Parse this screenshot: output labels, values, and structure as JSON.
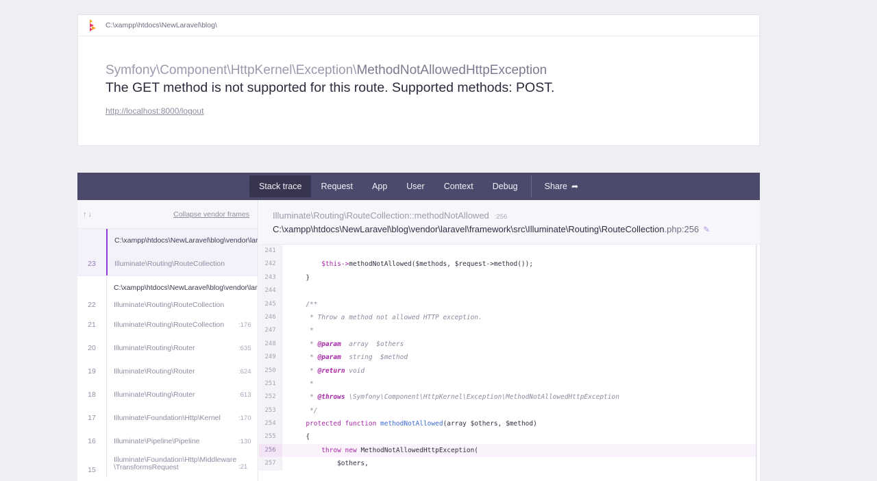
{
  "header": {
    "path": "C:\\xampp\\htdocs\\NewLaravel\\blog\\",
    "exception_namespace": "Symfony\\Component\\HttpKernel\\Exception\\",
    "exception_class": "MethodNotAllowedHttpException",
    "message": "The GET method is not supported for this route. Supported methods: POST.",
    "url": "http://localhost:8000/logout"
  },
  "tabs": [
    {
      "label": "Stack trace"
    },
    {
      "label": "Request"
    },
    {
      "label": "App"
    },
    {
      "label": "User"
    },
    {
      "label": "Context"
    },
    {
      "label": "Debug"
    },
    {
      "label": "Share"
    }
  ],
  "sidebar": {
    "arrows": "↑↓",
    "collapse_label": "Collapse vendor frames",
    "active_group_path": "C:\\xampp\\htdocs\\NewLaravel\\blog\\vendor\\laravel",
    "second_group_path": "C:\\xampp\\htdocs\\NewLaravel\\blog\\vendor\\laravel",
    "frames": [
      {
        "num": "23",
        "cls": "Illuminate\\Routing\\RouteCollection",
        "line": ""
      },
      {
        "num": "22",
        "cls": "Illuminate\\Routing\\RouteCollection",
        "line": ""
      },
      {
        "num": "21",
        "cls": "Illuminate\\Routing\\RouteCollection",
        "line": ":176"
      },
      {
        "num": "20",
        "cls": "Illuminate\\Routing\\Router",
        "line": ":635"
      },
      {
        "num": "19",
        "cls": "Illuminate\\Routing\\Router",
        "line": ":624"
      },
      {
        "num": "18",
        "cls": "Illuminate\\Routing\\Router",
        "line": ":613"
      },
      {
        "num": "17",
        "cls": "Illuminate\\Foundation\\Http\\Kernel",
        "line": ":170"
      },
      {
        "num": "16",
        "cls": "Illuminate\\Pipeline\\Pipeline",
        "line": ":130"
      },
      {
        "num": "15",
        "cls": "Illuminate\\Foundation\\Http\\Middleware\\TransformsRequest",
        "line": ":21"
      }
    ]
  },
  "source": {
    "method": "Illuminate\\Routing\\RouteCollection::methodNotAllowed",
    "method_line": ":256",
    "file_path": "C:\\xampp\\htdocs\\NewLaravel\\blog\\vendor\\laravel\\framework\\src\\Illuminate\\Routing\\RouteCollection",
    "file_ext": ".php:256",
    "lines": [
      {
        "n": "241",
        "code": ""
      },
      {
        "n": "242",
        "code": "        $this->methodNotAllowed($methods, $request->method());"
      },
      {
        "n": "243",
        "code": "    }"
      },
      {
        "n": "244",
        "code": ""
      },
      {
        "n": "245",
        "code": "    /**"
      },
      {
        "n": "246",
        "code": "     * Throw a method not allowed HTTP exception."
      },
      {
        "n": "247",
        "code": "     *"
      },
      {
        "n": "248",
        "code": "     * @param  array  $others"
      },
      {
        "n": "249",
        "code": "     * @param  string  $method"
      },
      {
        "n": "250",
        "code": "     * @return void"
      },
      {
        "n": "251",
        "code": "     *"
      },
      {
        "n": "252",
        "code": "     * @throws \\Symfony\\Component\\HttpKernel\\Exception\\MethodNotAllowedHttpException"
      },
      {
        "n": "253",
        "code": "     */"
      },
      {
        "n": "254",
        "code": "    protected function methodNotAllowed(array $others, $method)"
      },
      {
        "n": "255",
        "code": "    {"
      },
      {
        "n": "256",
        "code": "        throw new MethodNotAllowedHttpException("
      },
      {
        "n": "257",
        "code": "            $others,"
      }
    ],
    "highlight_line": "256"
  },
  "colors": {
    "tabbar": "#4c4a6c",
    "accent": "#8b3fd8",
    "background": "#eeeef3"
  }
}
